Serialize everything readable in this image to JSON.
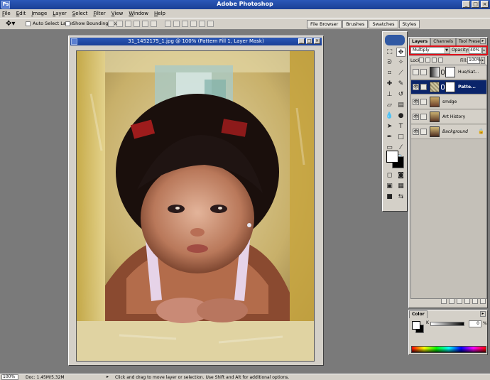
{
  "app": {
    "title": "Adobe Photoshop",
    "icon_label": "Ps"
  },
  "menu": [
    "File",
    "Edit",
    "Image",
    "Layer",
    "Select",
    "Filter",
    "View",
    "Window",
    "Help"
  ],
  "options_bar": {
    "auto_select_label": "Auto Select Layer",
    "bounding_box_label": "Show Bounding Box",
    "palette_well": [
      "File Browser",
      "Brushes",
      "Swatches",
      "Styles"
    ]
  },
  "document": {
    "title": "31_1452175_1.jpg @ 100% (Pattern Fill 1, Layer Mask)"
  },
  "layers_panel": {
    "tabs": [
      "Layers",
      "Channels",
      "Tool Presets"
    ],
    "blend_mode": "Multiply",
    "opacity_label": "Opacity:",
    "opacity": "40%",
    "lock_label": "Lock:",
    "fill_label": "Fill:",
    "fill": "100%",
    "layers": [
      {
        "name": "Hue/Sat..."
      },
      {
        "name": "Patte..."
      },
      {
        "name": "smdge"
      },
      {
        "name": "Art History"
      },
      {
        "name": "Background"
      }
    ]
  },
  "color_panel": {
    "tab": "Color",
    "channel_label": "K",
    "value": "0",
    "unit": "%"
  },
  "status_bar": {
    "zoom": "100%",
    "doc_info": "Doc: 1.45M/5.32M",
    "hint": "Click and drag to move layer or selection. Use Shift and Alt for additional options."
  },
  "colors": {
    "title_bar": "#1a3f96",
    "selected_layer": "#0a246a",
    "highlight": "#e0101a",
    "ui_gray": "#d4d0c8"
  }
}
